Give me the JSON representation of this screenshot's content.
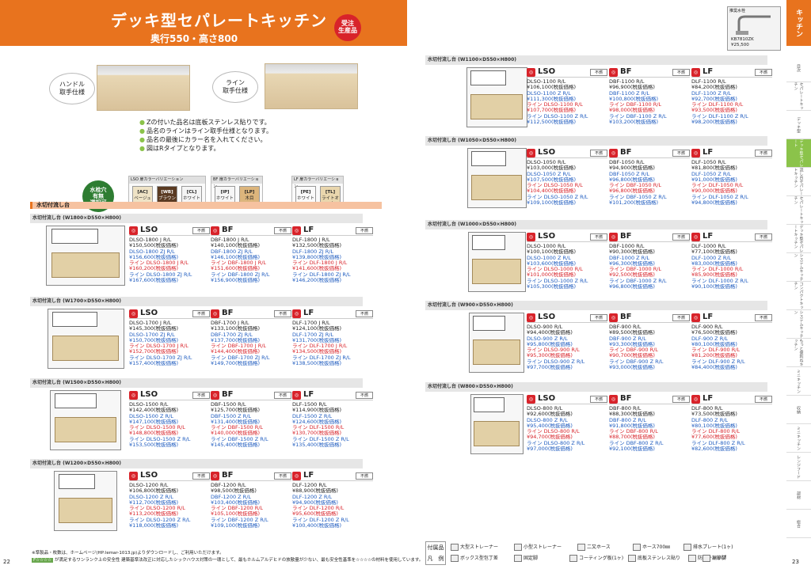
{
  "header": {
    "title": "デッキ型セパレートキッチン",
    "subtitle": "奥行550・高さ800",
    "badge": "受注\n生産品"
  },
  "faucet": {
    "label": "推奨水栓",
    "code": "KB7810ZK\n¥25,500"
  },
  "callouts": [
    {
      "text": "ハンドル\n取手仕様"
    },
    {
      "text": "ライン\n取手仕様"
    }
  ],
  "bullets": [
    "Zの付いた品名は底板ステンレス貼りです。",
    "品名のラインはライン取手仕様となります。",
    "品名の最後にカラー名を入れてください。",
    "図はRタイプとなります。"
  ],
  "sink_badge": "水栓穴\n有無\n選択可",
  "color_groups": [
    {
      "title": "LSO 扉カラーバリエーション",
      "swatches": [
        {
          "code": "[AC]",
          "name": "ベージュ",
          "color": "#efe3c6"
        },
        {
          "code": "[WB]",
          "name": "ブラウン",
          "color": "#5a3a22"
        },
        {
          "code": "[CL]",
          "name": "ホワイト",
          "color": "#f4f4f4"
        }
      ]
    },
    {
      "title": "BF 扉カラーバリエーション",
      "swatches": [
        {
          "code": "[IP]",
          "name": "ホワイト",
          "color": "#f6f6f6"
        },
        {
          "code": "[LP]",
          "name": "木目",
          "color": "#dcb57c"
        }
      ]
    },
    {
      "title": "LF 扉カラーバリエーション",
      "swatches": [
        {
          "code": "[PE]",
          "name": "ホワイト",
          "color": "#fafafa"
        },
        {
          "code": "[TL]",
          "name": "ライトオーク",
          "color": "#e9d6ad"
        }
      ]
    }
  ],
  "section_bar": "水切付流し台",
  "series_names": [
    "LSO",
    "BF",
    "LF"
  ],
  "icon_label": "不燃",
  "groups": [
    {
      "title": "水切付流し台 (W1800×D550×H800)",
      "lso": [
        "DLSO-1800 J R/L",
        "¥150,500(税抜価格)",
        "DLSO-1800 ZJ R/L",
        "¥156,600(税抜価格)",
        "ライン DLSO-1800 J R/L",
        "¥160,200(税抜価格)",
        "ライン DLSO-1800 ZJ R/L",
        "¥167,600(税抜価格)"
      ],
      "bf": [
        "DBF-1800 J R/L",
        "¥140,100(税抜価格)",
        "DBF-1800 ZJ R/L",
        "¥146,100(税抜価格)",
        "ライン DBF-1800 J R/L",
        "¥151,600(税抜価格)",
        "ライン DBF-1800 ZJ R/L",
        "¥156,900(税抜価格)"
      ],
      "lf": [
        "DLF-1800 J R/L",
        "¥132,500(税抜価格)",
        "DLF-1800 ZJ R/L",
        "¥139,800(税抜価格)",
        "ライン DLF-1800 J R/L",
        "¥141,600(税抜価格)",
        "ライン DLF-1800 ZJ R/L",
        "¥146,200(税抜価格)"
      ]
    },
    {
      "title": "水切付流し台 (W1700×D550×H800)",
      "lso": [
        "DLSO-1700 J R/L",
        "¥145,300(税抜価格)",
        "DLSO-1700 ZJ R/L",
        "¥150,700(税抜価格)",
        "ライン DLSO-1700 J R/L",
        "¥152,700(税抜価格)",
        "ライン DLSO-1700 ZJ R/L",
        "¥157,400(税抜価格)"
      ],
      "bf": [
        "DBF-1700 J R/L",
        "¥133,100(税抜価格)",
        "DBF-1700 ZJ R/L",
        "¥137,700(税抜価格)",
        "ライン DBF-1700 J R/L",
        "¥144,400(税抜価格)",
        "ライン DBF-1700 ZJ R/L",
        "¥149,700(税抜価格)"
      ],
      "lf": [
        "DLF-1700 J R/L",
        "¥124,100(税抜価格)",
        "DLF-1700 ZJ R/L",
        "¥131,700(税抜価格)",
        "ライン DLF-1700 J R/L",
        "¥134,500(税抜価格)",
        "ライン DLF-1700 ZJ R/L",
        "¥138,500(税抜価格)"
      ]
    },
    {
      "title": "水切付流し台 (W1500×D550×H800)",
      "lso": [
        "DLSO-1500 R/L",
        "¥142,400(税抜価格)",
        "DLSO-1500 Z R/L",
        "¥147,100(税抜価格)",
        "ライン DLSO-1500 R/L",
        "¥148,800(税抜価格)",
        "ライン DLSO-1500 Z R/L",
        "¥153,500(税抜価格)"
      ],
      "bf": [
        "DBF-1500 R/L",
        "¥125,700(税抜価格)",
        "DBF-1500 Z R/L",
        "¥131,400(税抜価格)",
        "ライン DBF-1500 R/L",
        "¥140,000(税抜価格)",
        "ライン DBF-1500 Z R/L",
        "¥145,400(税抜価格)"
      ],
      "lf": [
        "DLF-1500 R/L",
        "¥114,900(税抜価格)",
        "DLF-1500 Z R/L",
        "¥124,600(税抜価格)",
        "ライン DLF-1500 R/L",
        "¥130,700(税抜価格)",
        "ライン DLF-1500 Z R/L",
        "¥135,400(税抜価格)"
      ]
    },
    {
      "title": "水切付流し台 (W1200×D550×H800)",
      "lso": [
        "DLSO-1200 R/L",
        "¥106,800(税抜価格)",
        "DLSO-1200 Z R/L",
        "¥112,700(税抜価格)",
        "ライン DLSO-1200 R/L",
        "¥113,200(税抜価格)",
        "ライン DLSO-1200 Z R/L",
        "¥118,000(税抜価格)"
      ],
      "bf": [
        "DBF-1200 R/L",
        "¥98,500(税抜価格)",
        "DBF-1200 Z R/L",
        "¥103,400(税抜価格)",
        "ライン DBF-1200 R/L",
        "¥105,100(税抜価格)",
        "ライン DBF-1200 Z R/L",
        "¥109,100(税抜価格)"
      ],
      "lf": [
        "DLF-1200 R/L",
        "¥88,900(税抜価格)",
        "DLF-1200 Z R/L",
        "¥94,900(税抜価格)",
        "ライン DLF-1200 R/L",
        "¥95,600(税抜価格)",
        "ライン DLF-1200 Z R/L",
        "¥100,400(税抜価格)"
      ]
    },
    {
      "title": "水切付流し台 (W1100×D550×H800)",
      "lso": [
        "DLSO-1100 R/L",
        "¥106,100(税抜価格)",
        "DLSO-1100 Z R/L",
        "¥111,300(税抜価格)",
        "ライン DLSO-1100 R/L",
        "¥107,700(税抜価格)",
        "ライン DLSO-1100 Z R/L",
        "¥112,500(税抜価格)"
      ],
      "bf": [
        "DBF-1100 R/L",
        "¥96,900(税抜価格)",
        "DBF-1100 Z R/L",
        "¥100,800(税抜価格)",
        "ライン DBF-1100 R/L",
        "¥98,000(税抜価格)",
        "ライン DBF-1100 Z R/L",
        "¥103,200(税抜価格)"
      ],
      "lf": [
        "DLF-1100 R/L",
        "¥84,200(税抜価格)",
        "DLF-1100 Z R/L",
        "¥92,700(税抜価格)",
        "ライン DLF-1100 R/L",
        "¥93,500(税抜価格)",
        "ライン DLF-1100 Z R/L",
        "¥98,200(税抜価格)"
      ]
    },
    {
      "title": "水切付流し台 (W1050×D550×H800)",
      "lso": [
        "DLSO-1050 R/L",
        "¥103,000(税抜価格)",
        "DLSO-1050 Z R/L",
        "¥107,500(税抜価格)",
        "ライン DLSO-1050 R/L",
        "¥104,400(税抜価格)",
        "ライン DLSO-1050 Z R/L",
        "¥109,100(税抜価格)"
      ],
      "bf": [
        "DBF-1050 R/L",
        "¥94,900(税抜価格)",
        "DBF-1050 Z R/L",
        "¥96,800(税抜価格)",
        "ライン DBF-1050 R/L",
        "¥96,800(税抜価格)",
        "ライン DBF-1050 Z R/L",
        "¥101,200(税抜価格)"
      ],
      "lf": [
        "DLF-1050 R/L",
        "¥81,800(税抜価格)",
        "DLF-1050 Z R/L",
        "¥91,000(税抜価格)",
        "ライン DLF-1050 R/L",
        "¥90,000(税抜価格)",
        "ライン DLF-1050 Z R/L",
        "¥94,800(税抜価格)"
      ]
    },
    {
      "title": "水切付流し台 (W1000×D550×H800)",
      "lso": [
        "DLSO-1000 R/L",
        "¥100,100(税抜価格)",
        "DLSO-1000 Z R/L",
        "¥103,600(税抜価格)",
        "ライン DLSO-1000 R/L",
        "¥101,000(税抜価格)",
        "ライン DLSO-1000 Z R/L",
        "¥105,300(税抜価格)"
      ],
      "bf": [
        "DBF-1000 R/L",
        "¥90,300(税抜価格)",
        "DBF-1000 Z R/L",
        "¥96,300(税抜価格)",
        "ライン DBF-1000 R/L",
        "¥92,500(税抜価格)",
        "ライン DBF-1000 Z R/L",
        "¥96,800(税抜価格)"
      ],
      "lf": [
        "DLF-1000 R/L",
        "¥77,100(税抜価格)",
        "DLF-1000 Z R/L",
        "¥83,000(税抜価格)",
        "ライン DLF-1000 R/L",
        "¥85,900(税抜価格)",
        "ライン DLF-1000 Z R/L",
        "¥90,100(税抜価格)"
      ]
    },
    {
      "title": "水切付流し台 (W900×D550×H800)",
      "lso": [
        "DLSO-900 R/L",
        "¥94,400(税抜価格)",
        "DLSO-900 Z R/L",
        "¥95,800(税抜価格)",
        "ライン DLSO-900 R/L",
        "¥95,300(税抜価格)",
        "ライン DLSO-900 Z R/L",
        "¥97,700(税抜価格)"
      ],
      "bf": [
        "DBF-900 R/L",
        "¥89,500(税抜価格)",
        "DBF-900 Z R/L",
        "¥93,300(税抜価格)",
        "ライン DBF-900 R/L",
        "¥90,700(税抜価格)",
        "ライン DBF-900 Z R/L",
        "¥93,000(税抜価格)"
      ],
      "lf": [
        "DLF-900 R/L",
        "¥76,500(税抜価格)",
        "DLF-900 Z R/L",
        "¥80,100(税抜価格)",
        "ライン DLF-900 R/L",
        "¥81,200(税抜価格)",
        "ライン DLF-900 Z R/L",
        "¥84,400(税抜価格)"
      ]
    },
    {
      "title": "水切付流し台 (W800×D550×H800)",
      "lso": [
        "DLSO-800 R/L",
        "¥92,600(税抜価格)",
        "DLSO-800 Z R/L",
        "¥95,400(税抜価格)",
        "ライン DLSO-800 R/L",
        "¥94,700(税抜価格)",
        "ライン DLSO-800 Z R/L",
        "¥97,000(税抜価格)"
      ],
      "bf": [
        "DBF-800 R/L",
        "¥88,300(税抜価格)",
        "DBF-800 Z R/L",
        "¥91,800(税抜価格)",
        "ライン DBF-800 R/L",
        "¥88,700(税抜価格)",
        "ライン DBF-800 Z R/L",
        "¥92,100(税抜価格)"
      ],
      "lf": [
        "DLF-800 R/L",
        "¥73,500(税抜価格)",
        "DLF-800 Z R/L",
        "¥80,100(税抜価格)",
        "ライン DLF-800 R/L",
        "¥77,600(税抜価格)",
        "ライン DLF-800 Z R/L",
        "¥82,600(税抜価格)"
      ]
    }
  ],
  "sidebar": {
    "main": "キッチン",
    "items": [
      "目次",
      "セパレートキッチン",
      "デッキ型",
      "デッキ型セパレート",
      "流し台セパレートキッチン",
      "セパレートキッチン",
      "デッキ型セパレートキッチン",
      "システムキッチン",
      "コンパクトキッチン",
      "システムキッチン",
      "もっと便利ねキッチン",
      "ミニキッチン",
      "収納",
      "ミニキッチン",
      "レンジフード",
      "部材",
      "総合"
    ]
  },
  "footer": {
    "note": "※準製品・枚数は、ホームページ(HP:lemar-1013.jp)よりダウンロードし、ご利用いただけます。",
    "chip": "F☆☆☆☆",
    "note2": "が満足するワンランク上の安全性 建築基準法改正に対応したシックハウス対策の一環として、最もホルムアルデヒドの放散量が少ない、最も安全性基準を☆☆☆☆の材料を使用しています。",
    "page_left": "22",
    "page_right": "23"
  },
  "accessories": {
    "title": "付属品\n凡　例",
    "items": [
      "大型ストレーナー",
      "小型ストレーナー",
      "二又ホース",
      "ホース700㎜",
      "防臭キャップ",
      "ボックス型包丁差",
      "固定脚",
      "コーティング板(1ヶ)",
      "底板ステンレス貼り",
      "調節脚",
      "排水プレート(1ヶ)"
    ]
  }
}
